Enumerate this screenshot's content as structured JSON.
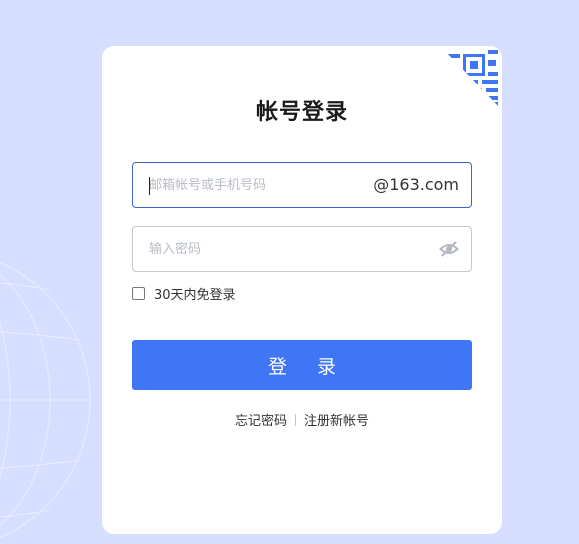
{
  "login": {
    "title": "帐号登录",
    "account_placeholder": "邮箱帐号或手机号码",
    "account_suffix": "@163.com",
    "password_placeholder": "输入密码",
    "remember_label": "30天内免登录",
    "submit_label": "登 录",
    "forgot_link": "忘记密码",
    "register_link": "注册新帐号"
  },
  "icons": {
    "qr": "qr-code-icon",
    "password_toggle": "eye-slash-icon"
  },
  "colors": {
    "background": "#d6dfff",
    "primary": "#3e76f5",
    "focus_border": "#3a67c8",
    "qr": "#3e76f5"
  }
}
